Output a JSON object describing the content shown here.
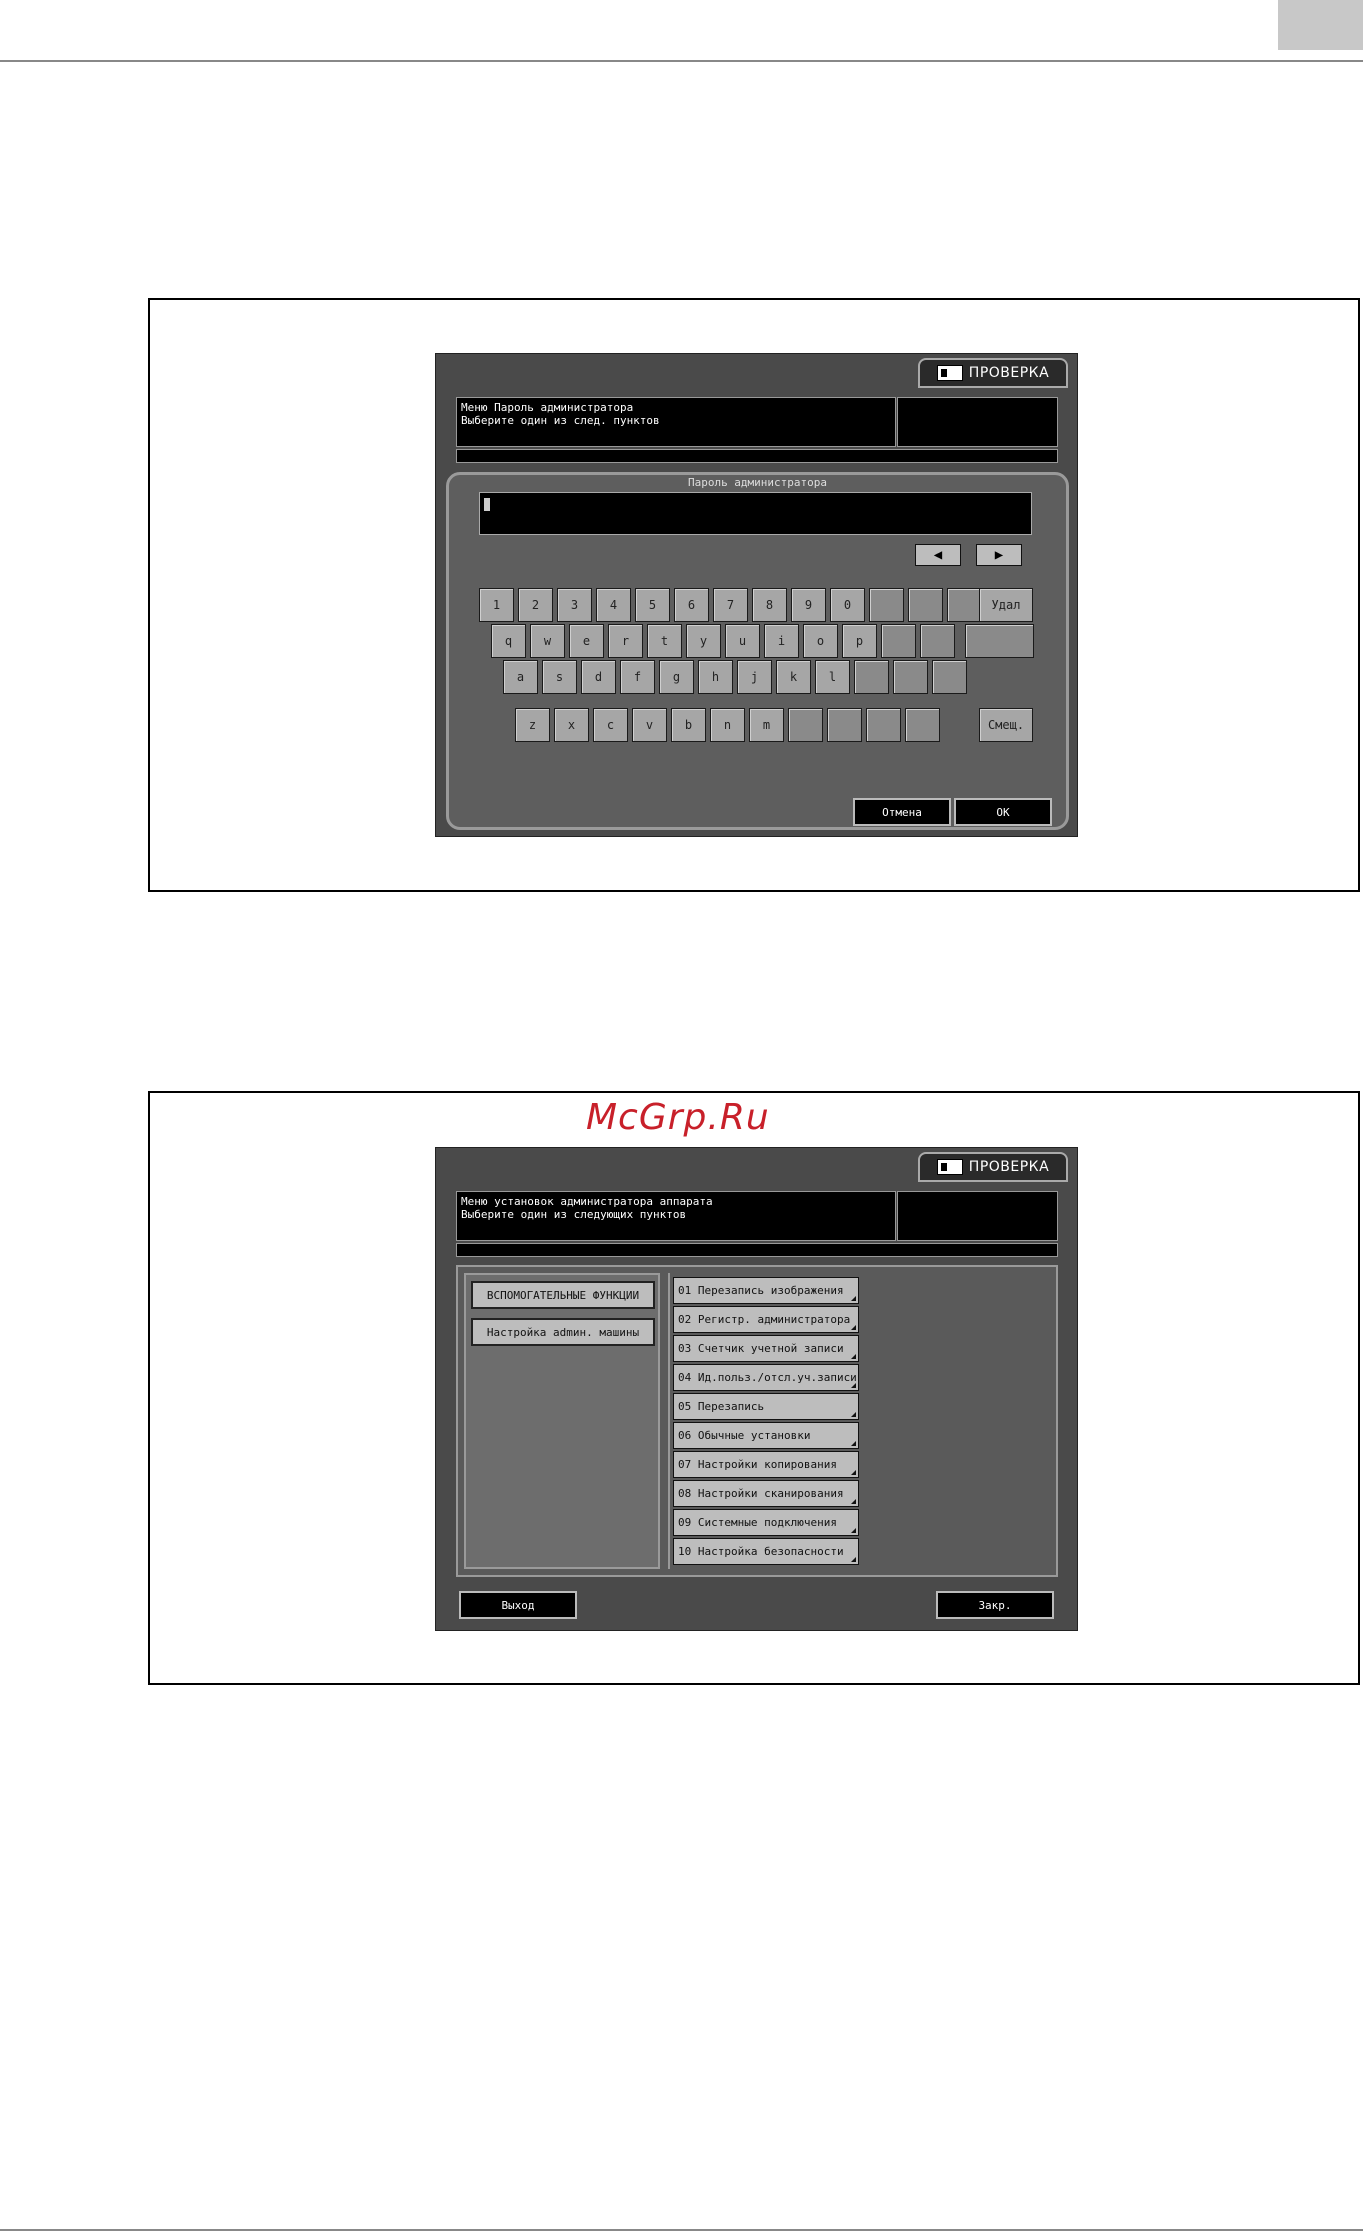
{
  "watermark": "McGrp.Ru",
  "screen1": {
    "check_label": "ПРОВЕРКА",
    "message_line1": "Меню Пароль администратора",
    "message_line2": "Выберите один из след. пунктов",
    "password_title": "Пароль администратора",
    "left_arrow": "◀",
    "right_arrow": "▶",
    "row1": [
      "1",
      "2",
      "3",
      "4",
      "5",
      "6",
      "7",
      "8",
      "9",
      "0"
    ],
    "row2": [
      "q",
      "w",
      "e",
      "r",
      "t",
      "y",
      "u",
      "i",
      "o",
      "p"
    ],
    "row3": [
      "a",
      "s",
      "d",
      "f",
      "g",
      "h",
      "j",
      "k",
      "l"
    ],
    "row4": [
      "z",
      "x",
      "c",
      "v",
      "b",
      "n",
      "m"
    ],
    "delete_label": "Удал",
    "shift_label": "Смещ.",
    "cancel_label": "Отмена",
    "ok_label": "OK"
  },
  "screen2": {
    "check_label": "ПРОВЕРКА",
    "message_line1": "Меню установок администратора аппарата",
    "message_line2": "Выберите один из следующих пунктов",
    "tab_aux": "ВСПОМОГАТЕЛЬНЫЕ ФУНКЦИИ",
    "tab_admin": "Настройка admин. машины",
    "items": [
      "01 Перезапись изображения",
      "02 Регистр. администратора",
      "03 Счетчик учетной записи",
      "04 Ид.польз./отсл.уч.записи",
      "05 Перезапись",
      "06 Обычные установки",
      "07 Настройки копирования",
      "08 Настройки сканирования",
      "09 Системные подключения",
      "10 Настройка безопасности"
    ],
    "exit_label": "Выход",
    "close_label": "Закр."
  }
}
